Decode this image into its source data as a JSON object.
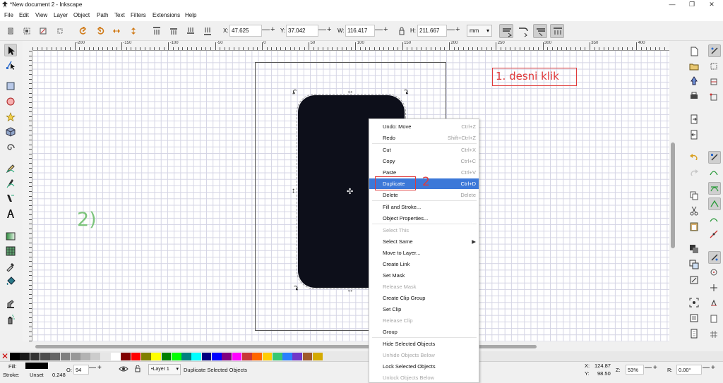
{
  "window": {
    "title": "*New document 2 - Inkscape",
    "controls": [
      "—",
      "❐",
      "✕"
    ]
  },
  "menubar": {
    "items": [
      "File",
      "Edit",
      "View",
      "Layer",
      "Object",
      "Path",
      "Text",
      "Filters",
      "Extensions",
      "Help"
    ]
  },
  "toolbar": {
    "x_label": "X:",
    "x_value": "47.625",
    "y_label": "Y:",
    "y_value": "37.042",
    "w_label": "W:",
    "w_value": "116.417",
    "h_label": "H:",
    "h_value": "211.667",
    "unit": "mm",
    "plus": "+",
    "minus": "—",
    "lock_icon": "lock-icon"
  },
  "ruler": {
    "top_labels": [
      "-200",
      "-150",
      "-100",
      "-50",
      "0",
      "50",
      "100",
      "150",
      "200",
      "250",
      "300",
      "350",
      "400",
      "45"
    ]
  },
  "annotations": {
    "step1": "1. desni klik",
    "step2": "2",
    "left_note": "2)"
  },
  "context_menu": {
    "items": [
      {
        "label": "Undo: Move",
        "shortcut": "Ctrl+Z",
        "enabled": true
      },
      {
        "label": "Redo",
        "shortcut": "Shift+Ctrl+Z",
        "enabled": true
      },
      {
        "label": "Cut",
        "shortcut": "Ctrl+X",
        "enabled": true
      },
      {
        "label": "Copy",
        "shortcut": "Ctrl+C",
        "enabled": true
      },
      {
        "label": "Paste",
        "shortcut": "Ctrl+V",
        "enabled": true
      },
      {
        "label": "Duplicate",
        "shortcut": "Ctrl+D",
        "enabled": true,
        "highlighted": true
      },
      {
        "label": "Delete",
        "shortcut": "Delete",
        "enabled": true
      },
      {
        "label": "Fill and Stroke...",
        "shortcut": "",
        "enabled": true
      },
      {
        "label": "Object Properties...",
        "shortcut": "",
        "enabled": true
      },
      {
        "label": "Select This",
        "shortcut": "",
        "enabled": false
      },
      {
        "label": "Select Same",
        "shortcut": "",
        "enabled": true,
        "submenu": true
      },
      {
        "label": "Move to Layer...",
        "shortcut": "",
        "enabled": true
      },
      {
        "label": "Create Link",
        "shortcut": "",
        "enabled": true
      },
      {
        "label": "Set Mask",
        "shortcut": "",
        "enabled": true
      },
      {
        "label": "Release Mask",
        "shortcut": "",
        "enabled": false
      },
      {
        "label": "Create Clip Group",
        "shortcut": "",
        "enabled": true
      },
      {
        "label": "Set Clip",
        "shortcut": "",
        "enabled": true
      },
      {
        "label": "Release Clip",
        "shortcut": "",
        "enabled": false
      },
      {
        "label": "Group",
        "shortcut": "",
        "enabled": true
      },
      {
        "label": "Hide Selected Objects",
        "shortcut": "",
        "enabled": true
      },
      {
        "label": "Unhide Objects Below",
        "shortcut": "",
        "enabled": false
      },
      {
        "label": "Lock Selected Objects",
        "shortcut": "",
        "enabled": true
      },
      {
        "label": "Unlock Objects Below",
        "shortcut": "",
        "enabled": false
      }
    ]
  },
  "status": {
    "fill_label": "Fill:",
    "stroke_label": "Stroke:",
    "stroke_value": "Unset",
    "stroke_width": "0.248",
    "opacity_label": "O:",
    "opacity_value": "94",
    "layer": "•Layer 1",
    "message": "Duplicate Selected Objects",
    "x_label": "X:",
    "x_value": "124.87",
    "y_label": "Y:",
    "y_value": "98.50",
    "zoom_label": "Z:",
    "zoom_value": "53%",
    "rotation_label": "R:",
    "rotation_value": "0.00°"
  },
  "colors": {
    "object_fill": "#0d0f1a",
    "highlight": "#3c78d8",
    "annotation_red": "#e03a3a",
    "annotation_green": "#7dc47d"
  },
  "palette": [
    "#000000",
    "#1a1a1a",
    "#333333",
    "#4d4d4d",
    "#666666",
    "#808080",
    "#999999",
    "#b3b3b3",
    "#cccccc",
    "#e6e6e6",
    "#ffffff",
    "#800000",
    "#ff0000",
    "#808000",
    "#ffff00",
    "#008000",
    "#00ff00",
    "#008080",
    "#00ffff",
    "#000080",
    "#0000ff",
    "#800080",
    "#ff00ff",
    "#c83737",
    "#ff6600",
    "#ffcc00",
    "#37c871",
    "#2a7fff",
    "#7137c8",
    "#a05a2c",
    "#d4aa00"
  ]
}
